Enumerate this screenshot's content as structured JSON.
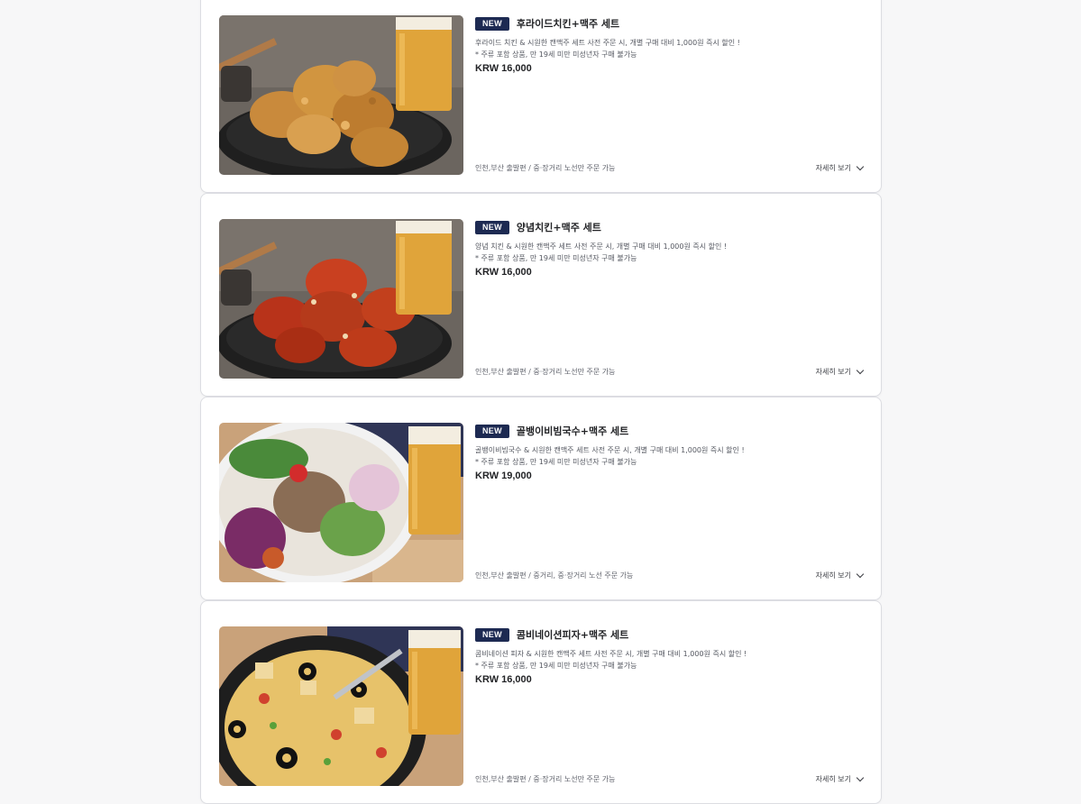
{
  "colors": {
    "badge_bg": "#1d2a52",
    "background": "#f7f7f8",
    "card_border": "#dcdde2"
  },
  "products": [
    {
      "badge": "NEW",
      "title": "후라이드치킨+맥주 세트",
      "desc_line1": "후라이드 치킨 & 시원한 캔맥주 세트 사전 주문 시, 개별 구매 대비 1,000원 즉시 할인 !",
      "desc_line2": "* 주류 포함 상품, 만 19세 미만 미성년자 구매 불가능",
      "price": "KRW 16,000",
      "availability": "인천,부산 출발편 / 중·장거리 노선만 주문 가능",
      "more_label": "자세히 보기",
      "image": "fried-chicken-with-beer"
    },
    {
      "badge": "NEW",
      "title": "양념치킨+맥주 세트",
      "desc_line1": "양념 치킨 & 시원한 캔맥주 세트 사전 주문 시, 개별 구매 대비 1,000원 즉시 할인 !",
      "desc_line2": "* 주류 포함 상품, 만 19세 미만 미성년자 구매 불가능",
      "price": "KRW 16,000",
      "availability": "인천,부산 출발편 / 중·장거리 노선만 주문 가능",
      "more_label": "자세히 보기",
      "image": "seasoned-chicken-with-beer"
    },
    {
      "badge": "NEW",
      "title": "골뱅이비빔국수+맥주 세트",
      "desc_line1": "골뱅이비빔국수 & 시원한 캔맥주 세트 사전 주문 시, 개별 구매 대비 1,000원 즉시 할인 !",
      "desc_line2": "* 주류 포함 상품, 만 19세 미만 미성년자 구매 불가능",
      "price": "KRW 19,000",
      "availability": "인천,부산 출발편 / 중거리, 중·장거리 노선 주문 가능",
      "more_label": "자세히 보기",
      "image": "whelk-noodles-with-beer"
    },
    {
      "badge": "NEW",
      "title": "콤비네이션피자+맥주 세트",
      "desc_line1": "콤비네이션 피자 & 시원한 캔맥주 세트 사전 주문 시, 개별 구매 대비 1,000원 즉시 할인 !",
      "desc_line2": "* 주류 포함 상품, 만 19세 미만 미성년자 구매 불가능",
      "price": "KRW 16,000",
      "availability": "인천,부산 출발편 / 중·장거리 노선만 주문 가능",
      "more_label": "자세히 보기",
      "image": "combination-pizza-with-beer"
    }
  ]
}
